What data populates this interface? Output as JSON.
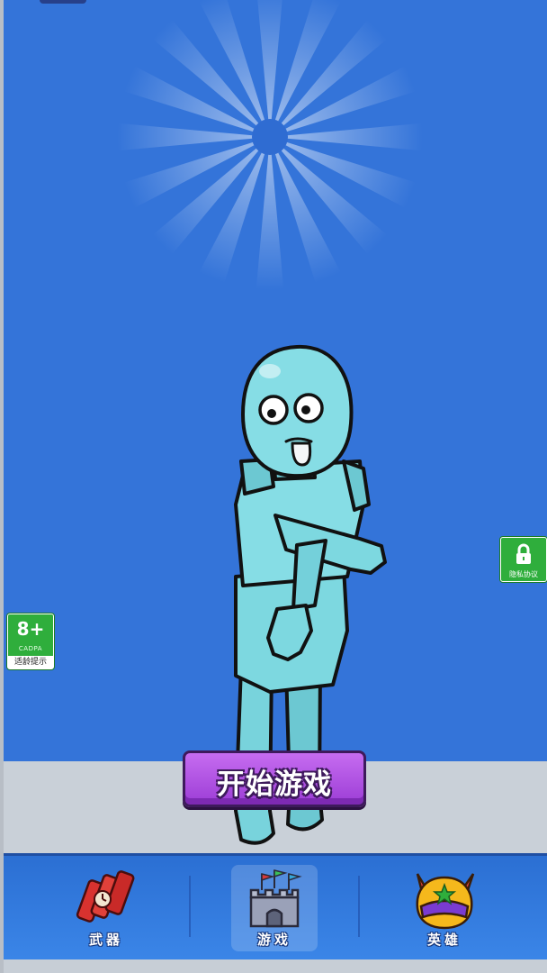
{
  "age_badge": {
    "rating": "8+",
    "org": "CADPA",
    "tip": "适龄提示"
  },
  "privacy_badge": {
    "label": "隐私协议"
  },
  "start_button": {
    "label": "开始游戏"
  },
  "bottom_nav": {
    "items": [
      {
        "label": "武器",
        "icon": "dynamite-icon",
        "active": false
      },
      {
        "label": "游戏",
        "icon": "castle-icon",
        "active": true
      },
      {
        "label": "英雄",
        "icon": "hero-mask-icon",
        "active": false
      }
    ]
  },
  "colors": {
    "sky": "#3474d9",
    "floor": "#c9d0d8",
    "button_purple": "#b154e6",
    "badge_green": "#2fae3c",
    "character": "#7dd8e0"
  }
}
